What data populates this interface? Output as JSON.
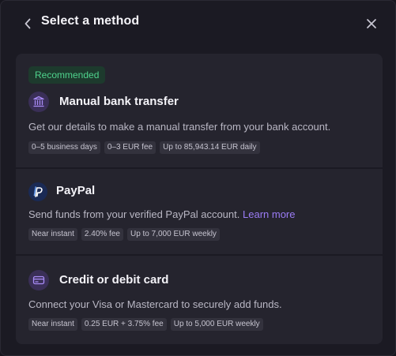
{
  "header": {
    "title": "Select a method",
    "back_icon": "chevron-left-icon",
    "close_icon": "close-icon"
  },
  "methods": [
    {
      "badge": "Recommended",
      "name": "Manual bank transfer",
      "icon": "bank-icon",
      "description": "Get our details to make a manual transfer from your bank account.",
      "tags": [
        "0–5 business days",
        "0–3 EUR fee",
        "Up to 85,943.14 EUR daily"
      ]
    },
    {
      "name": "PayPal",
      "icon": "paypal-icon",
      "description": "Send funds from your verified PayPal account.",
      "link": "Learn more",
      "tags": [
        "Near instant",
        "2.40% fee",
        "Up to 7,000 EUR weekly"
      ]
    },
    {
      "name": "Credit or debit card",
      "icon": "credit-card-icon",
      "description": "Connect your Visa or Mastercard to securely add funds.",
      "tags": [
        "Near instant",
        "0.25 EUR + 3.75% fee",
        "Up to 5,000 EUR weekly"
      ]
    }
  ],
  "colors": {
    "background": "#1b1a23",
    "card": "#25242e",
    "badge_bg": "#1d3a2d",
    "badge_text": "#4fd38d",
    "accent": "#9b7cf5",
    "tag_bg": "#33323d"
  }
}
